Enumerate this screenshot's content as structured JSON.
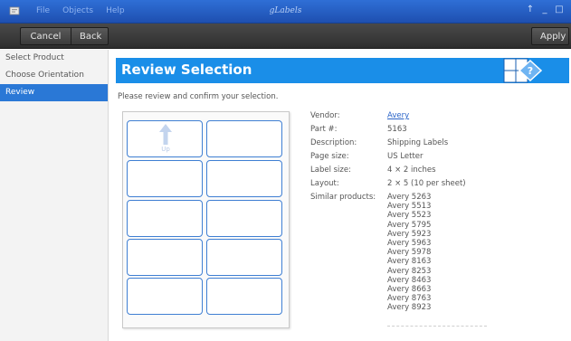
{
  "titlebar": {
    "menu": [
      "File",
      "Objects",
      "Help"
    ],
    "title": "gLabels",
    "controls": [
      "↑",
      "_",
      "□"
    ]
  },
  "toolbar": {
    "cancel_label": "Cancel",
    "back_label": "Back",
    "apply_label": "Apply"
  },
  "sidebar": {
    "items": [
      {
        "label": "Select Product"
      },
      {
        "label": "Choose Orientation"
      },
      {
        "label": "Review"
      }
    ]
  },
  "main": {
    "title": "Review Selection",
    "instruction": "Please review and confirm your selection.",
    "preview": {
      "up_label": "Up"
    }
  },
  "details": {
    "vendor_key": "Vendor:",
    "vendor_value": "Avery",
    "part_key": "Part #:",
    "part_value": "5163",
    "description_key": "Description:",
    "description_value": "Shipping Labels",
    "page_size_key": "Page size:",
    "page_size_value": "US Letter",
    "label_size_key": "Label size:",
    "label_size_value": "4 × 2 inches",
    "layout_key": "Layout:",
    "layout_value": "2 × 5 (10 per sheet)",
    "similar_key": "Similar products:",
    "similar": [
      "Avery 5263",
      "Avery 5513",
      "Avery 5523",
      "Avery 5795",
      "Avery 5923",
      "Avery 5963",
      "Avery 5978",
      "Avery 8163",
      "Avery 8253",
      "Avery 8463",
      "Avery 8663",
      "Avery 8763",
      "Avery 8923"
    ]
  },
  "colors": {
    "accent": "#1a8ee8",
    "sidebar_active": "#2a78d6",
    "label_border": "#3f7fd3"
  }
}
